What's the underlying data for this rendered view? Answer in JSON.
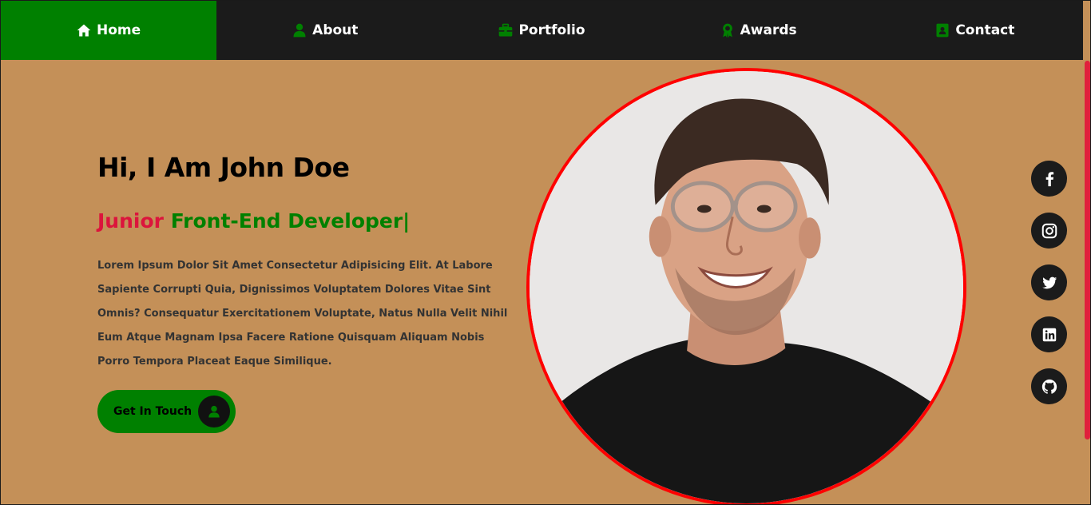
{
  "nav": {
    "items": [
      {
        "label": "Home",
        "icon": "home-icon",
        "active": true
      },
      {
        "label": "About",
        "icon": "user-icon",
        "active": false
      },
      {
        "label": "Portfolio",
        "icon": "briefcase-icon",
        "active": false
      },
      {
        "label": "Awards",
        "icon": "award-icon",
        "active": false
      },
      {
        "label": "Contact",
        "icon": "contact-card-icon",
        "active": false
      }
    ]
  },
  "hero": {
    "title": "Hi, I Am John Doe",
    "role_prefix": "Junior",
    "role_main": "Front-End Developer",
    "role_caret": "|",
    "description": "Lorem Ipsum Dolor Sit Amet Consectetur Adipisicing Elit. At Labore Sapiente Corrupti Quia, Dignissimos Voluptatem Dolores Vitae Sint Omnis? Consequatur Exercitationem Voluptate, Natus Nulla Velit Nihil Eum Atque Magnam Ipsa Facere Ratione Quisquam Aliquam Nobis Porro Tempora Placeat Eaque Similique.",
    "cta_label": "Get In Touch",
    "cta_icon": "user-icon"
  },
  "social": [
    {
      "name": "facebook-icon"
    },
    {
      "name": "instagram-icon"
    },
    {
      "name": "twitter-icon"
    },
    {
      "name": "linkedin-icon"
    },
    {
      "name": "github-icon"
    }
  ],
  "colors": {
    "background": "#c49058",
    "nav_bg": "#1b1b1b",
    "accent_green": "#008000",
    "accent_red": "#dc143c",
    "portrait_border": "#ff0000"
  }
}
